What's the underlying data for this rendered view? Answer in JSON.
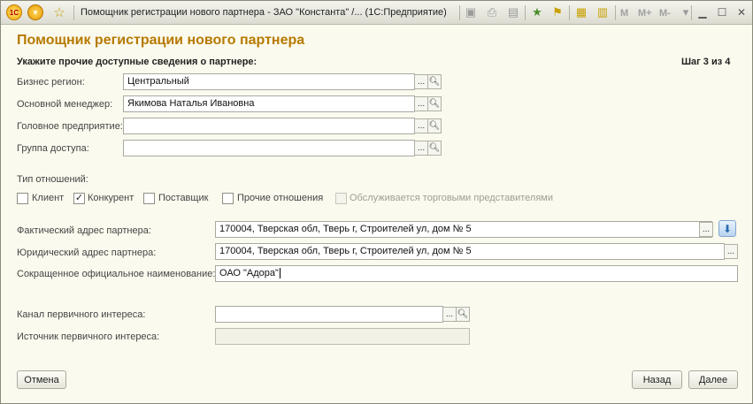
{
  "window": {
    "title": "Помощник регистрации нового партнера - ЗАО \"Константа\" /...  (1С:Предприятие)",
    "m_buttons": [
      "M",
      "M+",
      "M-"
    ]
  },
  "form": {
    "title": "Помощник регистрации нового партнера",
    "subheading": "Укажите прочие доступные сведения о партнере:",
    "step": "Шаг 3 из 4"
  },
  "fields": {
    "business_region": {
      "label": "Бизнес регион:",
      "value": "Центральный"
    },
    "main_manager": {
      "label": "Основной менеджер:",
      "value": "Якимова Наталья Ивановна"
    },
    "head_company": {
      "label": "Головное предприятие:",
      "value": ""
    },
    "access_group": {
      "label": "Группа доступа:",
      "value": ""
    }
  },
  "relations": {
    "label": "Тип отношений:",
    "options": [
      {
        "label": "Клиент",
        "checked": false
      },
      {
        "label": "Конкурент",
        "checked": true
      },
      {
        "label": "Поставщик",
        "checked": false
      },
      {
        "label": "Прочие отношения",
        "checked": false
      },
      {
        "label": "Обслуживается торговыми представителями",
        "checked": false,
        "disabled": true
      }
    ]
  },
  "addresses": {
    "actual": {
      "label": "Фактический адрес партнера:",
      "value": "170004, Тверская обл, Тверь г, Строителей ул, дом № 5"
    },
    "legal": {
      "label": "Юридический адрес партнера:",
      "value": "170004, Тверская обл, Тверь г, Строителей ул, дом № 5"
    },
    "short_name": {
      "label": "Сокращенное официальное наименование:",
      "value": "ОАО \"Адора\""
    }
  },
  "interest": {
    "channel": {
      "label": "Канал первичного интереса:",
      "value": ""
    },
    "source": {
      "label": "Источник первичного интереса:",
      "value": ""
    }
  },
  "buttons": {
    "cancel": "Отмена",
    "back": "Назад",
    "next": "Далее",
    "ellipsis": "...",
    "search_icon": "magnifier-icon",
    "copy_address_icon": "arrow-down-icon"
  }
}
